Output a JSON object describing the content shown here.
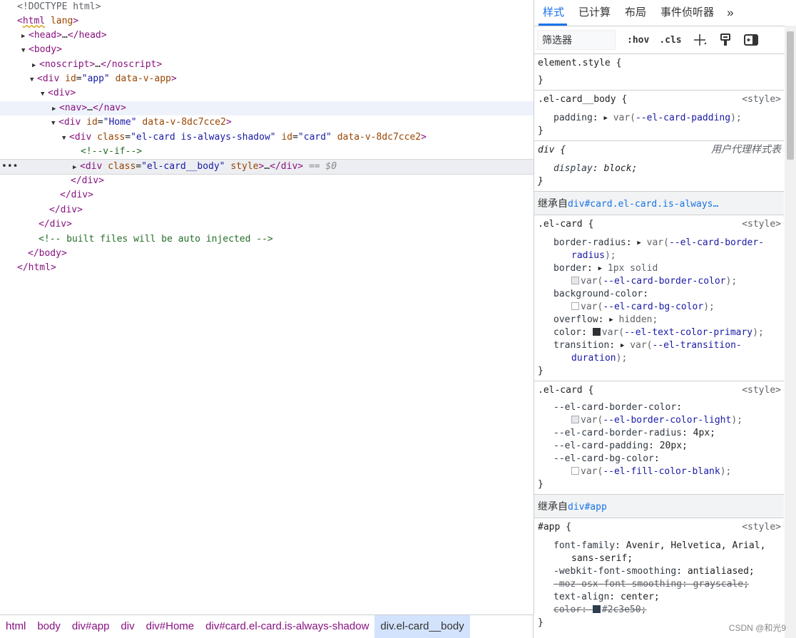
{
  "elements": {
    "doctype": "<!DOCTYPE html>",
    "html_open": "html",
    "html_attr": "lang",
    "head": "head",
    "head_close": "head",
    "body": "body",
    "noscript": "noscript",
    "noscript_close": "noscript",
    "div": "div",
    "id_attr": "id",
    "app_val": "\"app\"",
    "data_v_app": "data-v-app",
    "nav": "nav",
    "nav_close": "nav",
    "home_val": "\"Home\"",
    "data_v_8dc": "data-v-8dc7cce2",
    "class_attr": "class",
    "card_class": "\"el-card is-always-shadow\"",
    "card_id": "\"card\"",
    "v_if_comment": "<!--v-if-->",
    "card_body_class": "\"el-card__body\"",
    "style_attr": "style",
    "selected_marker": "== $0",
    "built_comment": "<!-- built files will be auto injected -->",
    "ellipsis": "…",
    "row_dots": "•••"
  },
  "breadcrumbs": [
    "html",
    "body",
    "div#app",
    "div",
    "div#Home",
    "div#card.el-card.is-always-shadow",
    "div.el-card__body"
  ],
  "tabs": [
    "样式",
    "已计算",
    "布局",
    "事件侦听器"
  ],
  "toolbar": {
    "filter_placeholder": "筛选器",
    "hov": ":hov",
    "cls": ".cls"
  },
  "styles": {
    "element_style": "element.style {",
    "close_brace": "}",
    "card_body_sel": ".el-card__body {",
    "style_src": "<style>",
    "padding_name": "padding",
    "padding_var": "--el-card-padding",
    "div_sel": "div {",
    "ua_src": "用户代理样式表",
    "display_name": "display",
    "display_val": "block;",
    "inherited_label": "继承自",
    "inherited_card": "div#card.el-card.is-always…",
    "el_card_sel": ".el-card {",
    "br_name": "border-radius",
    "br_var": "--el-card-border-",
    "br_var2": "radius",
    "border_name": "border",
    "border_val": "1px solid",
    "border_var": "--el-card-border-color",
    "bg_name": "background-color",
    "bg_var": "--el-card-bg-color",
    "overflow_name": "overflow",
    "overflow_val": "hidden;",
    "color_name": "color",
    "color_var": "--el-text-color-primary",
    "transition_name": "transition",
    "transition_var": "--el-transition-",
    "transition_var2": "duration",
    "v1_name": "--el-card-border-color",
    "v1_var": "--el-border-color-light",
    "v2_name": "--el-card-border-radius",
    "v2_val": "4px;",
    "v3_name": "--el-card-padding",
    "v3_val": "20px;",
    "v4_name": "--el-card-bg-color",
    "v4_var": "--el-fill-color-blank",
    "inherited_app": "div#app",
    "app_sel": "#app {",
    "ff_name": "font-family",
    "ff_val": "Avenir, Helvetica, Arial,",
    "ff_val2": "sans-serif;",
    "wfs_name": "-webkit-font-smoothing",
    "wfs_val": "antialiased;",
    "moz_line": "-moz-osx-font-smoothing: grayscale;",
    "ta_name": "text-align",
    "ta_val": "center;",
    "color2_line_name": "color",
    "color2_val": "#2c3e50;"
  },
  "watermark": "CSDN @和光9",
  "colors": {
    "accent": "#1a73e8",
    "tag": "#881280",
    "attr": "#994500",
    "value": "#1a1aa6",
    "comment": "#236e25"
  }
}
